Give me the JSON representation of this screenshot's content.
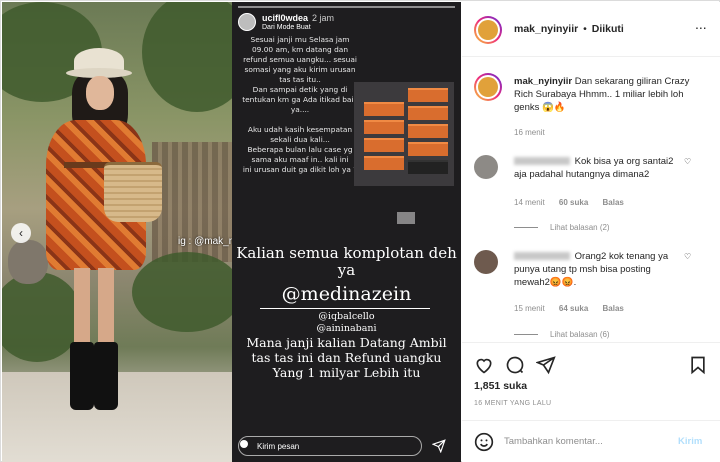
{
  "photo": {
    "tag": "ig : @mak_nyinyiir"
  },
  "story": {
    "username": "ucifl0wdea",
    "time": "2 jam",
    "source": "Dari Mode Buat",
    "text1": "Sesuai janji mu Selasa jam 09.00 am, km datang dan refund semua uangku... sesuai somasi yang aku kirim urusan tas tas itu..\nDan sampai detik yang di tentukan km ga Ada itikad baik ya....\n\nAku udah kasih kesempatan sekali dua kali...\nBeberapa bulan lalu case yg sama aku maaf in.. kali ini\nini urusan duit ga dikit loh ya ?",
    "big_text": "Kalian semua komplotan deh ya",
    "mention_main": "@medinazein",
    "mention_1": "@iqbalcello",
    "mention_2": "@aininabani",
    "body2": "Mana janji kalian Datang Ambil tas tas ini dan Refund uangku Yang 1 milyar Lebih itu",
    "reply_placeholder": "Kirim pesan"
  },
  "post": {
    "username": "mak_nyinyiir",
    "dot": "•",
    "follow_label": "Diikuti",
    "more": "...",
    "caption": "Dan sekarang giliran Crazy Rich Surabaya Hhmm.. 1 miliar lebih loh genks 😱🔥",
    "caption_time": "16 menit",
    "comments": [
      {
        "text": "Kok bisa ya org santai2 aja padahal hutangnya dimana2",
        "time": "14 menit",
        "likes": "60 suka",
        "reply_label": "Balas",
        "replies": "Lihat balasan (2)"
      },
      {
        "text": "Orang2 kok tenang ya punya utang tp msh bisa posting mewah2😡😡.",
        "time": "15 menit",
        "likes": "64 suka",
        "reply_label": "Balas",
        "replies": "Lihat balasan (6)"
      }
    ],
    "likes": "1,851 suka",
    "posted": "16 MENIT YANG LALU",
    "comment_placeholder": "Tambahkan komentar...",
    "send_label": "Kirim"
  },
  "colors": {
    "link_blue": "#b2dffc",
    "muted": "#8e8e8e",
    "story_bg": "#1e1d1f"
  }
}
